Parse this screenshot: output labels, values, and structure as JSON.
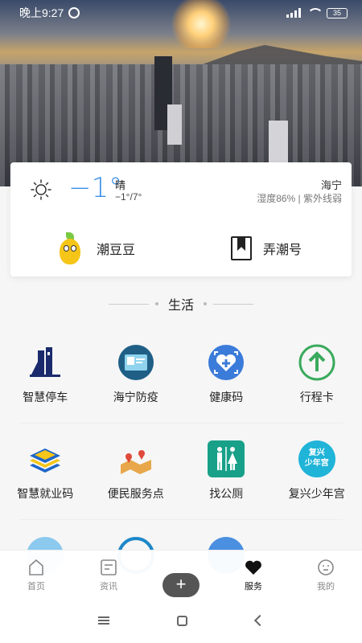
{
  "status_bar": {
    "time": "晚上9:27",
    "battery": "35"
  },
  "weather": {
    "temperature": "−1°",
    "condition": "晴",
    "range": "−1°/7°",
    "city": "海宁",
    "details": "湿度86% | 紫外线弱",
    "temp_color": "#3a8fe8"
  },
  "quick_links": [
    {
      "label": "潮豆豆",
      "icon": "bean-mascot-icon"
    },
    {
      "label": "弄潮号",
      "icon": "bookmark-icon"
    }
  ],
  "section": {
    "title": "生活"
  },
  "services": {
    "row1": [
      {
        "label": "智慧停车",
        "icon": "parking-building-icon"
      },
      {
        "label": "海宁防疫",
        "icon": "epidemic-card-icon"
      },
      {
        "label": "健康码",
        "icon": "health-code-icon"
      },
      {
        "label": "行程卡",
        "icon": "itinerary-arrow-icon"
      }
    ],
    "row2": [
      {
        "label": "智慧就业码",
        "icon": "employment-layers-icon"
      },
      {
        "label": "便民服务点",
        "icon": "map-pin-icon"
      },
      {
        "label": "找公厕",
        "icon": "restroom-icon"
      },
      {
        "label": "复兴少年宫",
        "icon": "youth-palace-icon",
        "badge": "复兴\n少年宫"
      }
    ]
  },
  "bottom_nav": [
    {
      "label": "首页",
      "icon": "home-icon"
    },
    {
      "label": "资讯",
      "icon": "news-icon"
    },
    {
      "label": "",
      "icon": "plus-icon"
    },
    {
      "label": "服务",
      "icon": "heart-icon",
      "active": true
    },
    {
      "label": "我的",
      "icon": "profile-icon"
    }
  ],
  "colors": {
    "accent_blue": "#3a8fe8",
    "green": "#3aaa5c",
    "teal": "#18a089"
  }
}
